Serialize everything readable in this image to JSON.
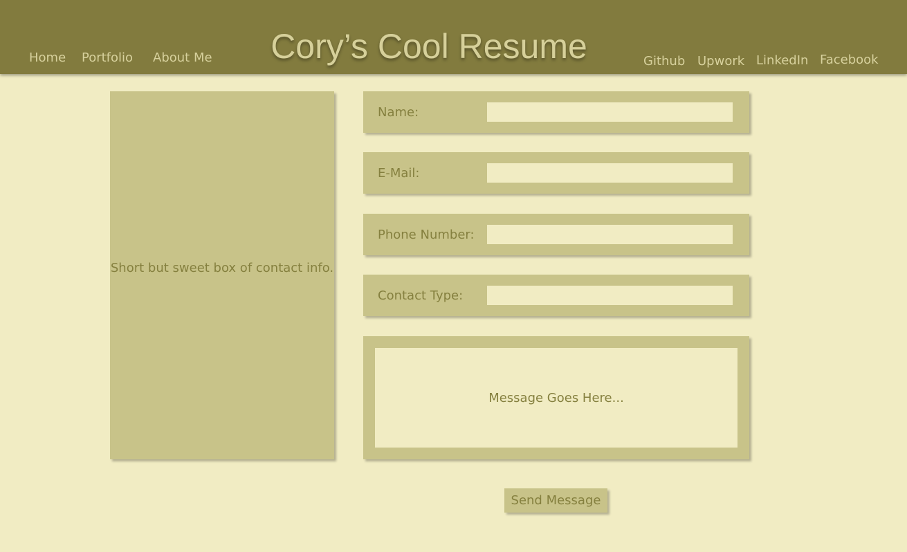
{
  "header": {
    "title": "Cory’s Cool Resume",
    "nav_left": [
      {
        "label": "Home"
      },
      {
        "label": "Portfolio"
      },
      {
        "label": "About Me"
      }
    ],
    "nav_right": [
      {
        "label": "Github"
      },
      {
        "label": "Upwork"
      },
      {
        "label": "LinkedIn"
      },
      {
        "label": "Facebook"
      }
    ]
  },
  "contact_info": {
    "text": "Short but sweet box of contact info."
  },
  "form": {
    "fields": [
      {
        "label": "Name:",
        "value": ""
      },
      {
        "label": "E-Mail:",
        "value": ""
      },
      {
        "label": "Phone Number:",
        "value": ""
      },
      {
        "label": "Contact Type:",
        "value": ""
      }
    ],
    "message_placeholder": "Message Goes Here...",
    "submit_label": "Send Message"
  },
  "colors": {
    "header_bg": "#827b3e",
    "page_bg": "#f1ecc3",
    "panel_bg": "#c8c389",
    "text": "#85803f",
    "header_text": "#d7d19d"
  }
}
